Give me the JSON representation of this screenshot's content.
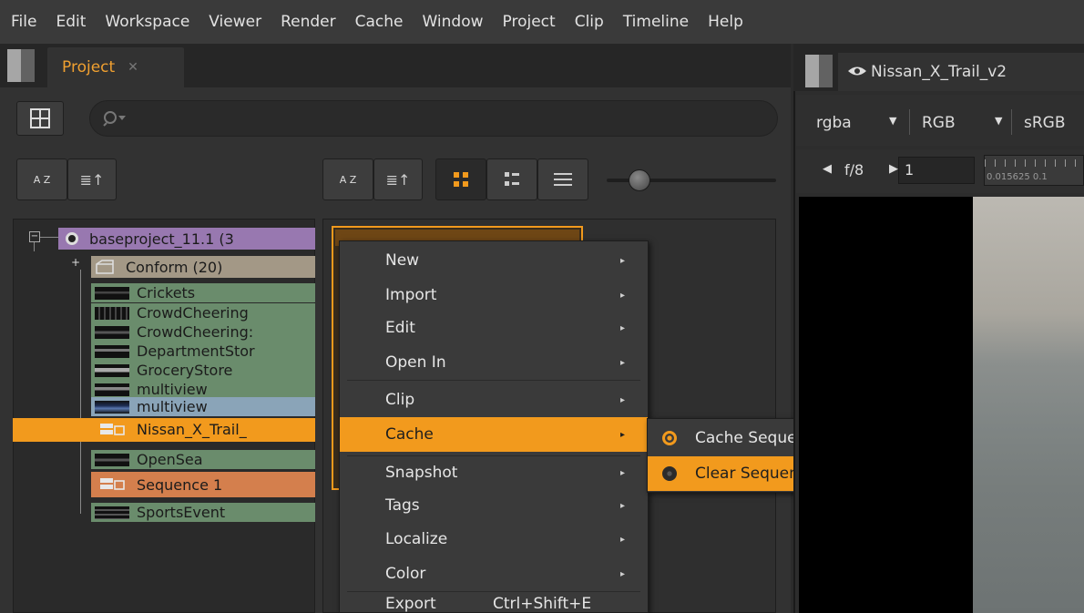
{
  "menubar": {
    "items": [
      "File",
      "Edit",
      "Workspace",
      "Viewer",
      "Render",
      "Cache",
      "Window",
      "Project",
      "Clip",
      "Timeline",
      "Help"
    ]
  },
  "project_panel": {
    "tab_label": "Project",
    "tree": {
      "root": "baseproject_11.1 (3",
      "items": [
        {
          "label": "Conform (20)",
          "icon": "bin-icon"
        },
        {
          "label": "Crickets",
          "icon": "clip-icon"
        },
        {
          "label": "CrowdCheering",
          "icon": "clip-icon"
        },
        {
          "label": "CrowdCheering:",
          "icon": "clip-icon"
        },
        {
          "label": "DepartmentStor",
          "icon": "clip-icon"
        },
        {
          "label": "GroceryStore",
          "icon": "clip-icon"
        },
        {
          "label": "multiview",
          "icon": "clip-icon"
        },
        {
          "label": "Nissan_X_Trail_",
          "icon": "sequence-icon"
        },
        {
          "label": "OpenSea",
          "icon": "clip-icon"
        },
        {
          "label": "Sequence 1",
          "icon": "sequence-icon"
        },
        {
          "label": "SportsEvent",
          "icon": "clip-icon"
        }
      ]
    },
    "sort_label": "A Z"
  },
  "context_menu": {
    "items": [
      {
        "label": "New",
        "submenu": true
      },
      {
        "label": "Import",
        "submenu": true
      },
      {
        "label": "Edit",
        "submenu": true
      },
      {
        "label": "Open In",
        "submenu": true
      },
      {
        "label": "Clip",
        "submenu": true
      },
      {
        "label": "Cache",
        "submenu": true
      },
      {
        "label": "Snapshot",
        "submenu": true
      },
      {
        "label": "Tags",
        "submenu": true
      },
      {
        "label": "Localize",
        "submenu": true
      },
      {
        "label": "Color",
        "submenu": true
      },
      {
        "label": "Export",
        "shortcut": "Ctrl+Shift+E"
      }
    ],
    "active": "Cache"
  },
  "cache_submenu": {
    "items": [
      "Cache Sequence Range",
      "Clear Sequence Range"
    ],
    "active": "Clear Sequence Range"
  },
  "viewer": {
    "tab_label": "Nissan_X_Trail_v2",
    "channels": "rgba",
    "color": "RGB",
    "lut": "sRGB",
    "fstop": "f/8",
    "frame": "1",
    "ruler_label": "0.015625 0.1"
  },
  "colors": {
    "accent": "#f29a1d",
    "row_green": "#6a8c6c",
    "row_purple": "#9878b0",
    "row_tan": "#a39886",
    "row_blue": "#8aa4b8",
    "row_selected": "#f29a1d",
    "row_sequence": "#d47f4d"
  }
}
